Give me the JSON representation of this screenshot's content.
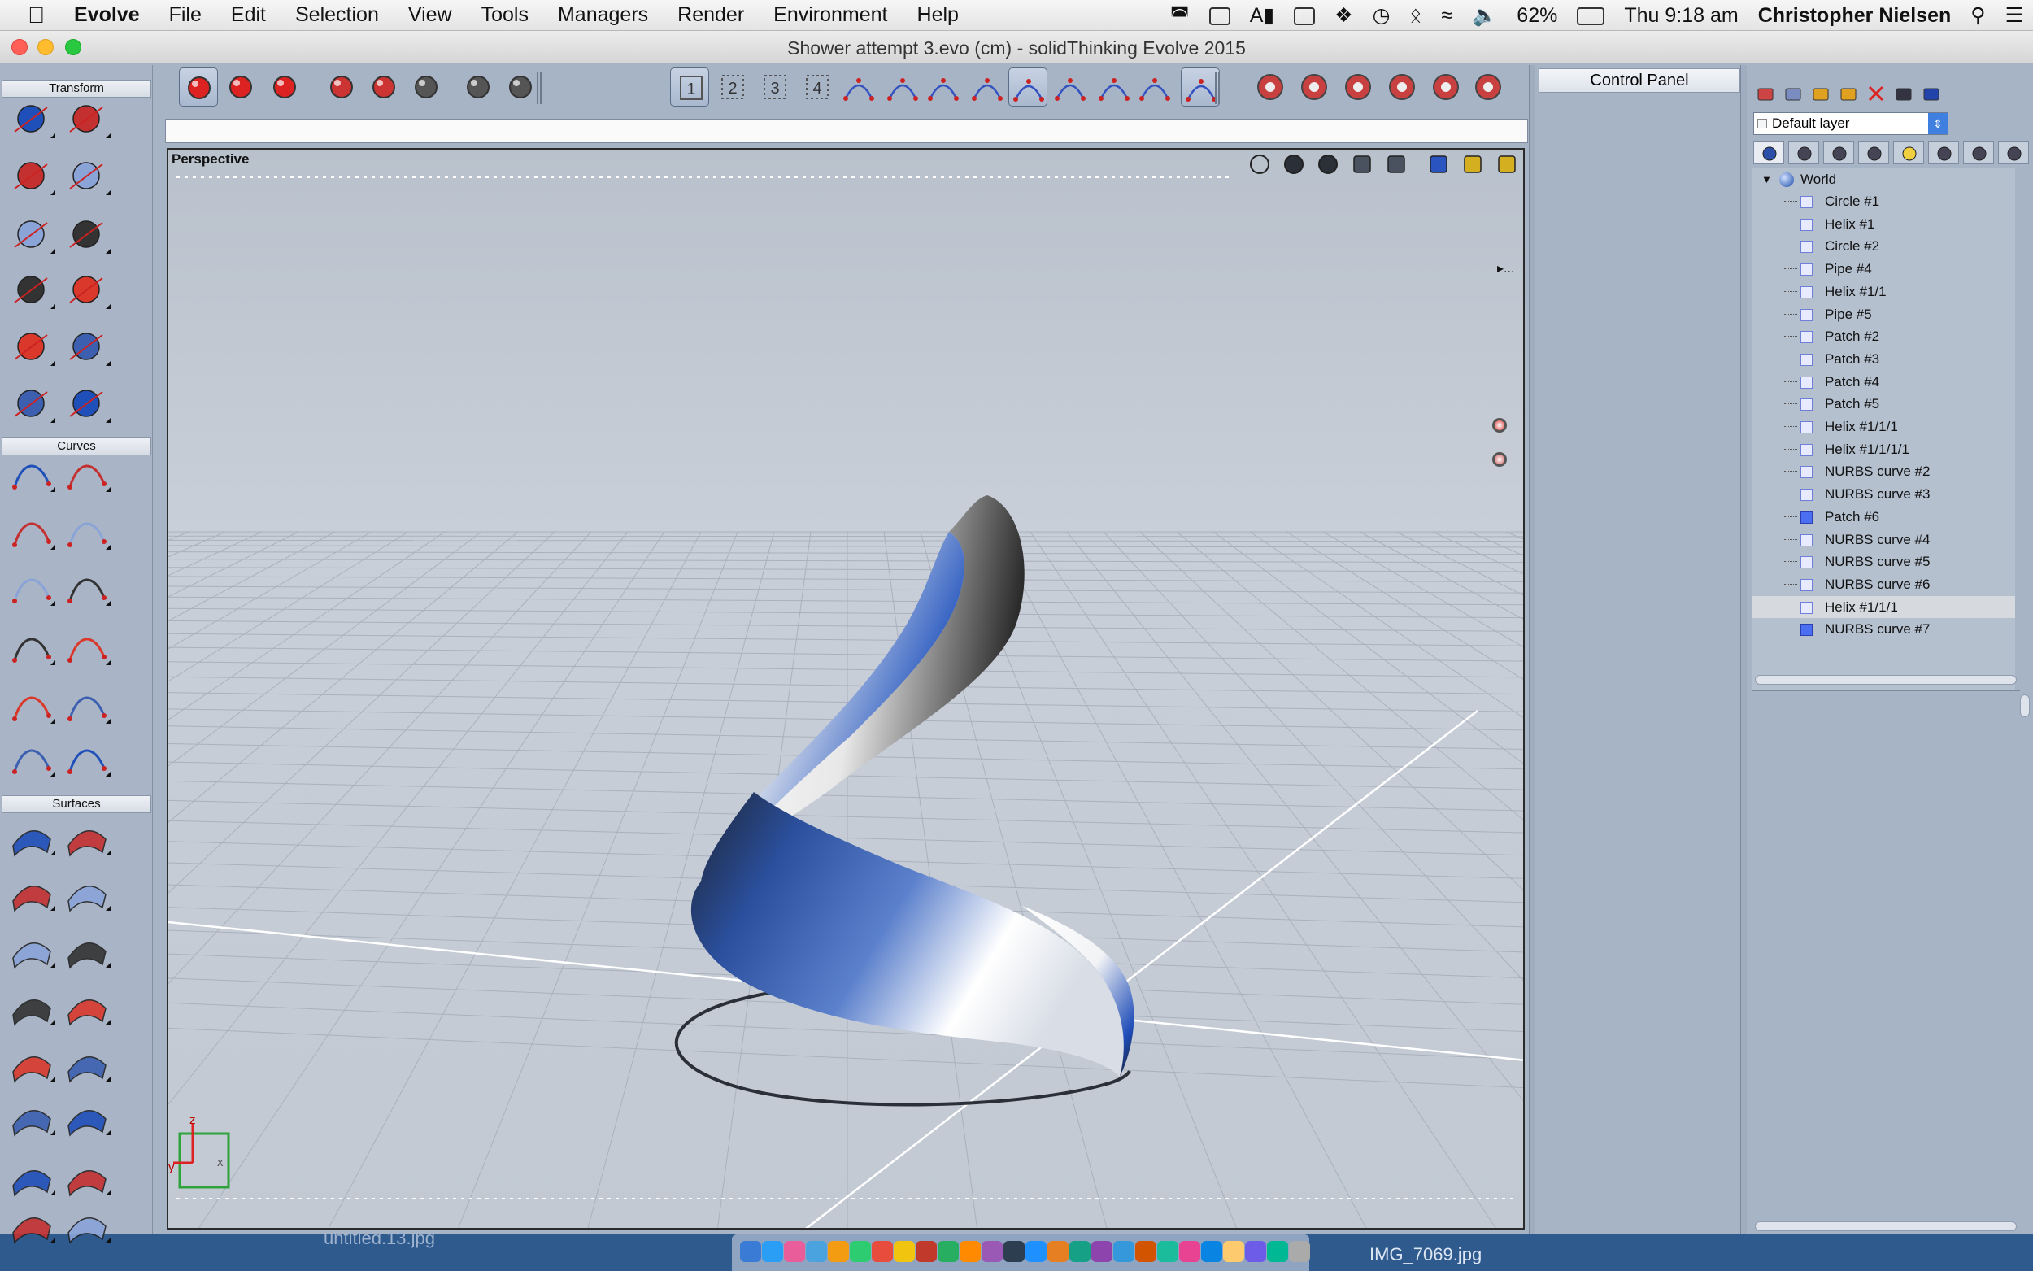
{
  "menubar": {
    "apple": "",
    "app": "Evolve",
    "items": [
      "File",
      "Edit",
      "Selection",
      "View",
      "Tools",
      "Managers",
      "Render",
      "Environment",
      "Help"
    ],
    "battery": "62%",
    "clock": "Thu 9:18 am",
    "user": "Christopher Nielsen"
  },
  "window": {
    "title": "Shower attempt 3.evo (cm) - solidThinking Evolve 2015"
  },
  "palette": {
    "transform": "Transform",
    "curves": "Curves",
    "surfaces": "Surfaces"
  },
  "toolbar": {
    "view_numbers": [
      "1",
      "2",
      "3",
      "4"
    ]
  },
  "viewport": {
    "label": "Perspective",
    "more": "▸..."
  },
  "control_panel": {
    "title": "Control Panel"
  },
  "layers": {
    "current": "Default layer"
  },
  "tree": {
    "root": "World",
    "items": [
      {
        "label": "Circle #1",
        "solid": false
      },
      {
        "label": "Helix #1",
        "solid": false
      },
      {
        "label": "Circle #2",
        "solid": false
      },
      {
        "label": "Pipe #4",
        "solid": false
      },
      {
        "label": "Helix #1/1",
        "solid": false
      },
      {
        "label": "Pipe #5",
        "solid": false
      },
      {
        "label": "Patch #2",
        "solid": false
      },
      {
        "label": "Patch #3",
        "solid": false
      },
      {
        "label": "Patch #4",
        "solid": false
      },
      {
        "label": "Patch #5",
        "solid": false
      },
      {
        "label": "Helix #1/1/1",
        "solid": false
      },
      {
        "label": "Helix #1/1/1/1",
        "solid": false
      },
      {
        "label": "NURBS curve #2",
        "solid": false
      },
      {
        "label": "NURBS curve #3",
        "solid": false
      },
      {
        "label": "Patch #6",
        "solid": true
      },
      {
        "label": "NURBS curve #4",
        "solid": false
      },
      {
        "label": "NURBS curve #5",
        "solid": false
      },
      {
        "label": "NURBS curve #6",
        "solid": false
      },
      {
        "label": "Helix #1/1/1",
        "solid": false,
        "selected": true
      },
      {
        "label": "NURBS curve #7",
        "solid": true
      }
    ]
  },
  "desktop": {
    "file_left": "untitled.13.jpg",
    "file_right": "IMG_7069.jpg"
  },
  "colors": {
    "accent": "#2a5fd0",
    "panel": "#a7b4c6",
    "viewport": "#c4cbd5"
  }
}
